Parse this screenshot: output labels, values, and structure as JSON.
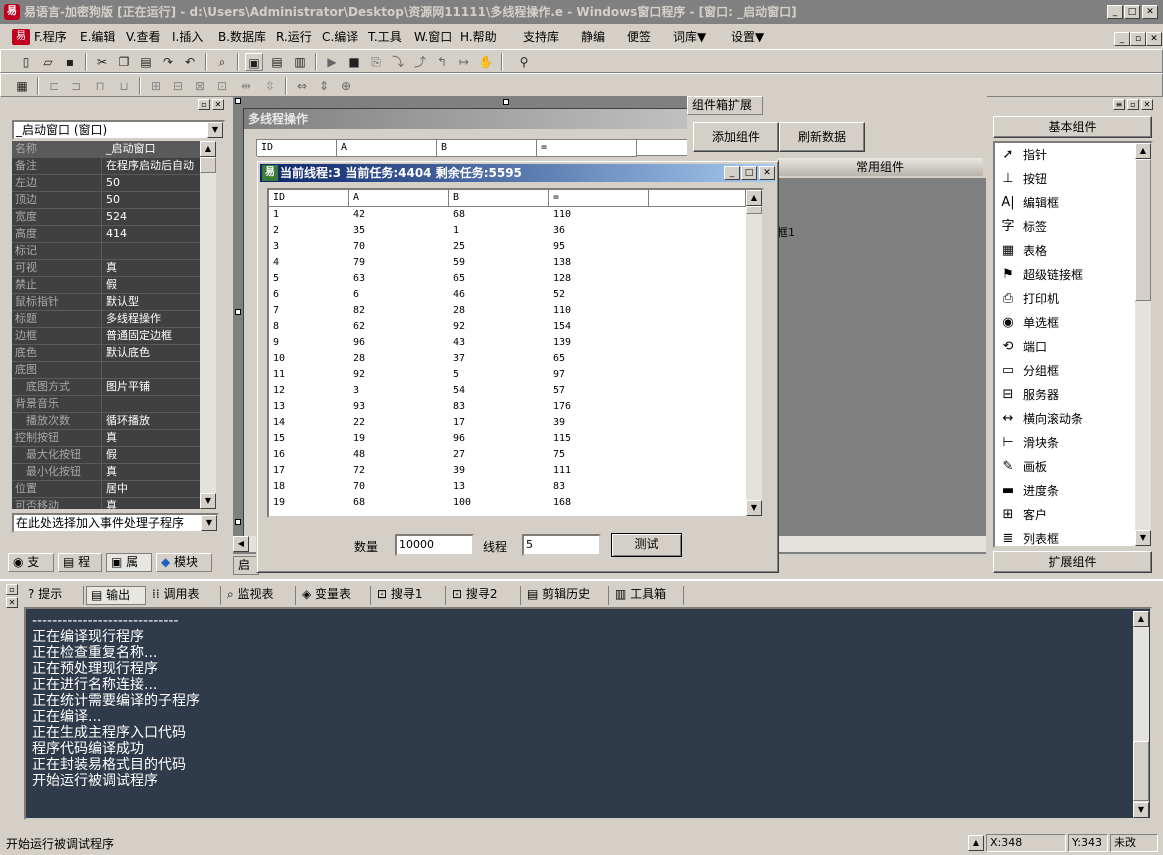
{
  "window": {
    "title": "易语言-加密狗版 [正在运行] - d:\\Users\\Administrator\\Desktop\\资源网11111\\多线程操作.e - Windows窗口程序 - [窗口: _启动窗口]"
  },
  "menu": {
    "items": [
      "F.程序",
      "E.编辑",
      "V.查看",
      "I.插入",
      "B.数据库",
      "R.运行",
      "C.编译",
      "T.工具",
      "W.窗口",
      "H.帮助",
      "支持库",
      "静编",
      "便签",
      "词库▼",
      "设置▼"
    ]
  },
  "left_panel": {
    "object_select": "_启动窗口 (窗口)",
    "properties": [
      {
        "name": "名称",
        "value": "_启动窗口"
      },
      {
        "name": "备注",
        "value": "在程序启动后自动"
      },
      {
        "name": "左边",
        "value": "50"
      },
      {
        "name": "顶边",
        "value": "50"
      },
      {
        "name": "宽度",
        "value": "524"
      },
      {
        "name": "高度",
        "value": "414"
      },
      {
        "name": "标记",
        "value": ""
      },
      {
        "name": "可视",
        "value": "真"
      },
      {
        "name": "禁止",
        "value": "假"
      },
      {
        "name": "鼠标指针",
        "value": "默认型"
      },
      {
        "name": "标题",
        "value": "多线程操作"
      },
      {
        "name": "边框",
        "value": "普通固定边框"
      },
      {
        "name": "底色",
        "value": "默认底色"
      },
      {
        "name": "底图",
        "value": ""
      },
      {
        "name": "底图方式",
        "value": "图片平铺"
      },
      {
        "name": "背景音乐",
        "value": ""
      },
      {
        "name": "播放次数",
        "value": "循环播放"
      },
      {
        "name": "控制按钮",
        "value": "真"
      },
      {
        "name": "最大化按钮",
        "value": "假"
      },
      {
        "name": "最小化按钮",
        "value": "真"
      },
      {
        "name": "位置",
        "value": "居中"
      },
      {
        "name": "可否移动",
        "value": "真"
      }
    ],
    "event_select": "在此处选择加入事件处理子程序",
    "tabs": [
      "支",
      "程",
      "属",
      "模块"
    ]
  },
  "designer": {
    "form_title": "多线程操作",
    "bg_headers": [
      "ID",
      "A",
      "B",
      "="
    ],
    "partial_label": "框1"
  },
  "component_tab": {
    "tab_label": "组件箱扩展",
    "add_button": "添加组件",
    "refresh_button": "刷新数据",
    "section": "常用组件"
  },
  "dialog": {
    "title": "当前线程:3 当前任务:4404 剩余任务:5595",
    "headers": [
      "ID",
      "A",
      "B",
      "="
    ],
    "rows": [
      [
        "1",
        "42",
        "68",
        "110"
      ],
      [
        "2",
        "35",
        "1",
        "36"
      ],
      [
        "3",
        "70",
        "25",
        "95"
      ],
      [
        "4",
        "79",
        "59",
        "138"
      ],
      [
        "5",
        "63",
        "65",
        "128"
      ],
      [
        "6",
        "6",
        "46",
        "52"
      ],
      [
        "7",
        "82",
        "28",
        "110"
      ],
      [
        "8",
        "62",
        "92",
        "154"
      ],
      [
        "9",
        "96",
        "43",
        "139"
      ],
      [
        "10",
        "28",
        "37",
        "65"
      ],
      [
        "11",
        "92",
        "5",
        "97"
      ],
      [
        "12",
        "3",
        "54",
        "57"
      ],
      [
        "13",
        "93",
        "83",
        "176"
      ],
      [
        "14",
        "22",
        "17",
        "39"
      ],
      [
        "15",
        "19",
        "96",
        "115"
      ],
      [
        "16",
        "48",
        "27",
        "75"
      ],
      [
        "17",
        "72",
        "39",
        "111"
      ],
      [
        "18",
        "70",
        "13",
        "83"
      ],
      [
        "19",
        "68",
        "100",
        "168"
      ]
    ],
    "count_label": "数量",
    "count_value": "10000",
    "thread_label": "线程",
    "thread_value": "5",
    "test_button": "测试"
  },
  "right_panel": {
    "basic_header": "基本组件",
    "items": [
      "指针",
      "按钮",
      "编辑框",
      "标签",
      "表格",
      "超级链接框",
      "打印机",
      "单选框",
      "端口",
      "分组框",
      "服务器",
      "横向滚动条",
      "滑块条",
      "画板",
      "进度条",
      "客户",
      "列表框"
    ],
    "icons": [
      "pointer-icon",
      "button-icon",
      "edit-box-icon",
      "label-icon",
      "table-icon",
      "hyperlink-icon",
      "printer-icon",
      "radio-icon",
      "port-icon",
      "groupbox-icon",
      "server-icon",
      "hscroll-icon",
      "slider-icon",
      "canvas-icon",
      "progress-icon",
      "client-icon",
      "listbox-icon"
    ],
    "ext_header": "扩展组件"
  },
  "bottom": {
    "tabs": [
      "提示",
      "输出",
      "调用表",
      "监视表",
      "变量表",
      "搜寻1",
      "搜寻2",
      "剪辑历史",
      "工具箱"
    ],
    "output_lines": [
      "-----------------------------",
      "正在编译现行程序",
      "正在检查重复名称...",
      "正在预处理现行程序",
      "正在进行名称连接...",
      "正在统计需要编译的子程序",
      "正在编译...",
      "正在生成主程序入口代码",
      "程序代码编译成功",
      "正在封装易格式目的代码",
      "开始运行被调试程序"
    ],
    "output_bg": "#2f3a4a"
  },
  "status": {
    "message": "开始运行被调试程序",
    "x": "X:348",
    "y": "Y:343",
    "modified": "未改"
  }
}
